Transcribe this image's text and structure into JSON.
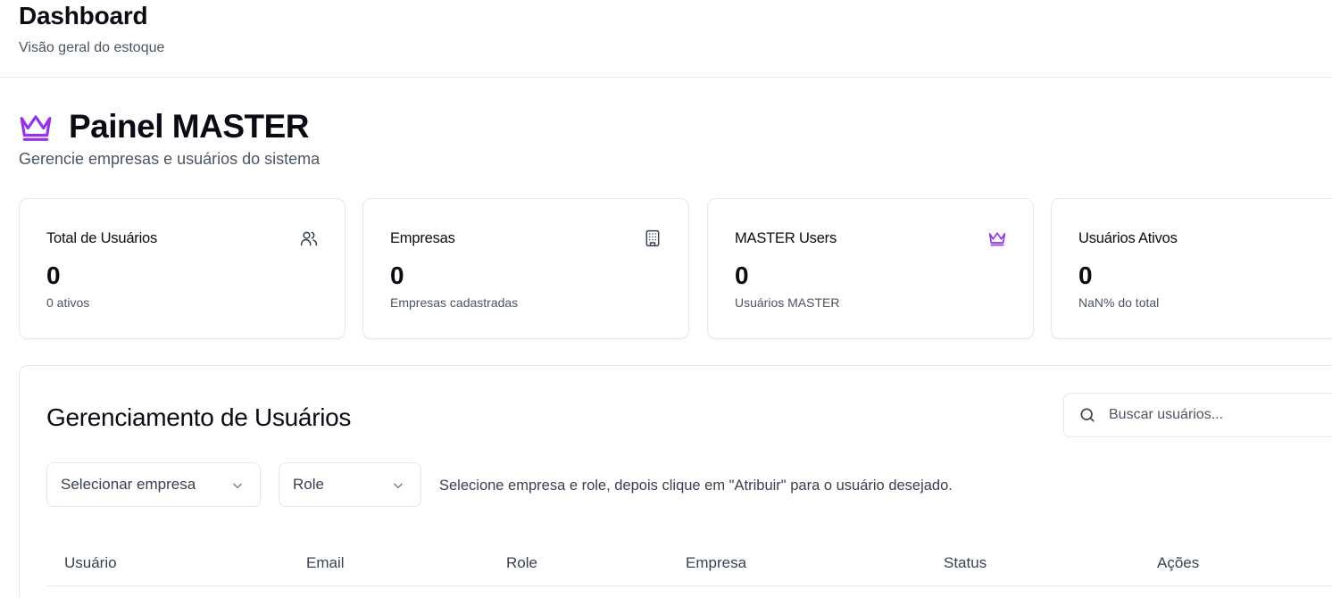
{
  "header": {
    "title": "Dashboard",
    "subtitle": "Visão geral do estoque"
  },
  "master": {
    "title": "Painel MASTER",
    "subtitle": "Gerencie empresas e usuários do sistema",
    "icon": "crown-icon",
    "accent": "#9333ea"
  },
  "cards": [
    {
      "title": "Total de Usuários",
      "value": "0",
      "description": "0 ativos",
      "icon": "users-icon"
    },
    {
      "title": "Empresas",
      "value": "0",
      "description": "Empresas cadastradas",
      "icon": "building-icon"
    },
    {
      "title": "MASTER Users",
      "value": "0",
      "description": "Usuários MASTER",
      "icon": "crown-icon"
    },
    {
      "title": "Usuários Ativos",
      "value": "0",
      "description": "NaN% do total",
      "icon": ""
    }
  ],
  "users_panel": {
    "title": "Gerenciamento de Usuários",
    "search_placeholder": "Buscar usuários...",
    "company_select": "Selecionar empresa",
    "role_select": "Role",
    "hint": "Selecione empresa e role, depois clique em \"Atribuir\" para o usuário desejado.",
    "columns": [
      "Usuário",
      "Email",
      "Role",
      "Empresa",
      "Status",
      "Ações"
    ]
  }
}
